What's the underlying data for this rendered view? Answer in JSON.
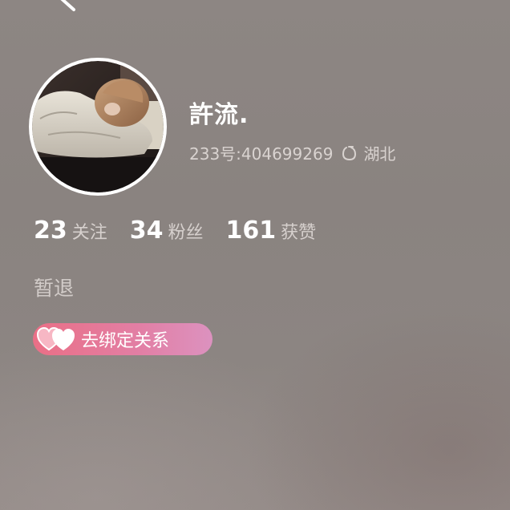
{
  "profile": {
    "nickname": "許流.",
    "id_text": "233号:404699269",
    "location": "湖北",
    "bio": "暂退"
  },
  "stats": [
    {
      "value": "23",
      "label": "关注"
    },
    {
      "value": "34",
      "label": "粉丝"
    },
    {
      "value": "161",
      "label": "获赞"
    }
  ],
  "relation": {
    "label": "去绑定关系"
  },
  "icons": {
    "avatar": "profile-photo",
    "location": "location-icon",
    "relation": "hearts-icon"
  },
  "colors": {
    "background": "#8c8582",
    "pill_start": "#ea6f86",
    "pill_end": "#dc92bf"
  }
}
